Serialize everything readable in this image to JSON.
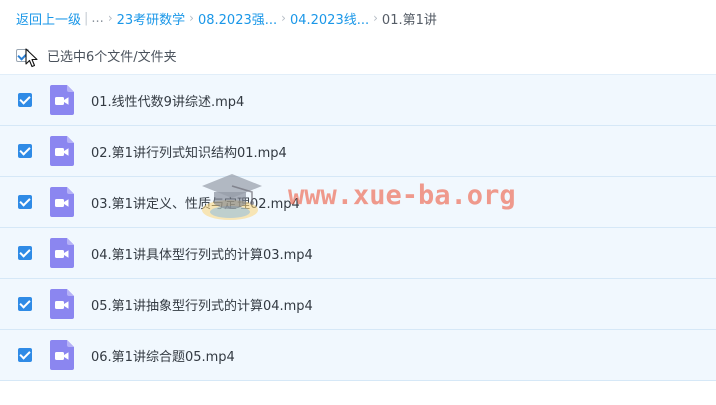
{
  "breadcrumb": {
    "back_label": "返回上一级",
    "ellipsis": "...",
    "items": [
      "23考研数学",
      "08.2023强...",
      "04.2023线..."
    ],
    "current": "01.第1讲"
  },
  "selection": {
    "summary": "已选中6个文件/文件夹",
    "all_checked": true
  },
  "files": [
    {
      "name": "01.线性代数9讲综述.mp4",
      "checked": true,
      "icon": "video-file-icon"
    },
    {
      "name": "02.第1讲行列式知识结构01.mp4",
      "checked": true,
      "icon": "video-file-icon"
    },
    {
      "name": "03.第1讲定义、性质与定理02.mp4",
      "checked": true,
      "icon": "video-file-icon"
    },
    {
      "name": "04.第1讲具体型行列式的计算03.mp4",
      "checked": true,
      "icon": "video-file-icon"
    },
    {
      "name": "05.第1讲抽象型行列式的计算04.mp4",
      "checked": true,
      "icon": "video-file-icon"
    },
    {
      "name": "06.第1讲综合题05.mp4",
      "checked": true,
      "icon": "video-file-icon"
    }
  ],
  "watermark": {
    "text": "www.xue-ba.org",
    "icon": "graduation-cap-icon"
  },
  "colors": {
    "link": "#1a97e8",
    "checkbox": "#2f8be6",
    "row_bg": "#f1f8fe",
    "video_icon": "#8b86f0",
    "watermark": "#ee6046"
  }
}
